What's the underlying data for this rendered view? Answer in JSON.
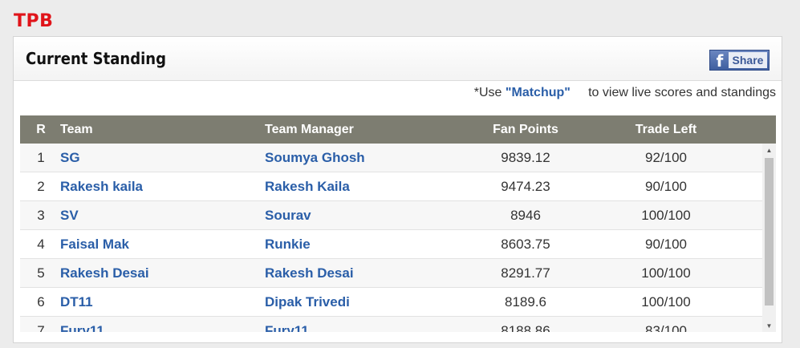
{
  "league_name": "TPB",
  "panel": {
    "title": "Current Standing",
    "share_label": "Share"
  },
  "note": {
    "prefix": "*Use",
    "link": "\"Matchup\"",
    "suffix": "to view live scores and standings"
  },
  "table": {
    "headers": {
      "rank": "R",
      "team": "Team",
      "manager": "Team Manager",
      "points": "Fan Points",
      "trade": "Trade Left"
    },
    "rows": [
      {
        "rank": "1",
        "team": "SG",
        "manager": "Soumya Ghosh",
        "points": "9839.12",
        "trade": "92/100"
      },
      {
        "rank": "2",
        "team": "Rakesh kaila",
        "manager": "Rakesh Kaila",
        "points": "9474.23",
        "trade": "90/100"
      },
      {
        "rank": "3",
        "team": "SV",
        "manager": "Sourav",
        "points": "8946",
        "trade": "100/100"
      },
      {
        "rank": "4",
        "team": "Faisal Mak",
        "manager": "Runkie",
        "points": "8603.75",
        "trade": "90/100"
      },
      {
        "rank": "5",
        "team": "Rakesh Desai",
        "manager": "Rakesh Desai",
        "points": "8291.77",
        "trade": "100/100"
      },
      {
        "rank": "6",
        "team": "DT11",
        "manager": "Dipak Trivedi",
        "points": "8189.6",
        "trade": "100/100"
      },
      {
        "rank": "7",
        "team": "Fury11",
        "manager": "Fury11",
        "points": "8188.86",
        "trade": "83/100"
      }
    ]
  },
  "icons": {
    "facebook": "facebook-icon",
    "scroll_up": "scroll-up-arrow-icon",
    "scroll_down": "scroll-down-arrow-icon"
  },
  "colors": {
    "league": "#e0141a",
    "header_bg": "#7d7d71",
    "link": "#2a5ea8",
    "facebook": "#3b5998"
  }
}
